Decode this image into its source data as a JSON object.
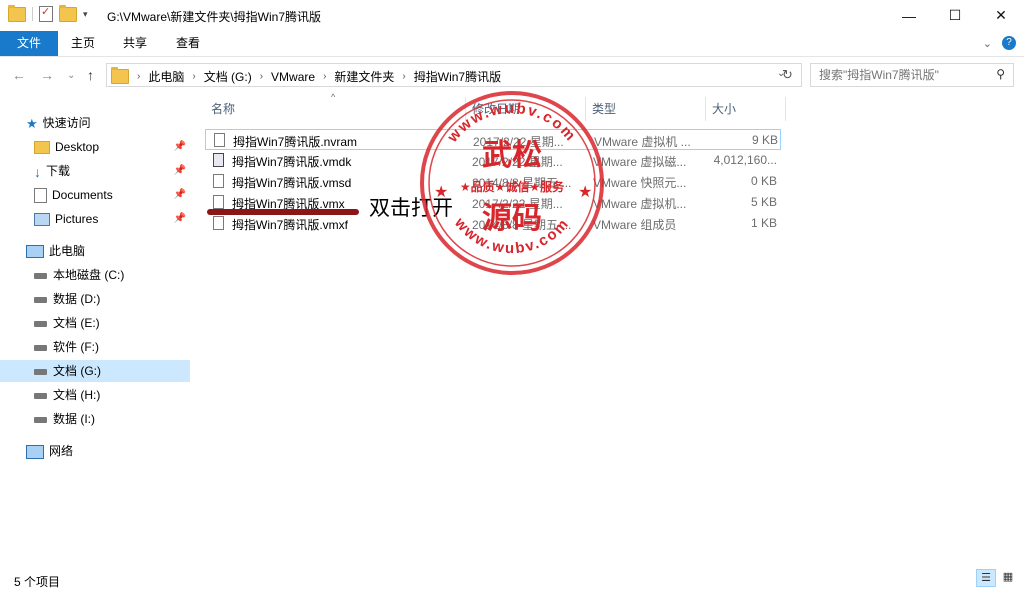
{
  "window": {
    "title": "G:\\VMware\\新建文件夹\\拇指Win7腾讯版",
    "minimize_label": "—",
    "maximize_label": "☐",
    "close_label": "✕"
  },
  "ribbon": {
    "tabs": [
      "文件",
      "主页",
      "共享",
      "查看"
    ],
    "expand_label": "⌄",
    "help_label": "?"
  },
  "address": {
    "crumbs": [
      "此电脑",
      "文档 (G:)",
      "VMware",
      "新建文件夹",
      "拇指Win7腾讯版"
    ]
  },
  "search": {
    "placeholder": "搜索\"拇指Win7腾讯版\""
  },
  "sidebar": {
    "quick_access": "快速访问",
    "pinned": [
      "Desktop",
      "下载",
      "Documents",
      "Pictures"
    ],
    "this_pc": "此电脑",
    "drives": [
      "本地磁盘 (C:)",
      "数据 (D:)",
      "文档 (E:)",
      "软件 (F:)",
      "文档 (G:)",
      "文档 (H:)",
      "数据 (I:)"
    ],
    "network": "网络"
  },
  "columns": [
    "名称",
    "修改日期",
    "类型",
    "大小"
  ],
  "files": [
    {
      "name": "拇指Win7腾讯版.nvram",
      "date": "2017/2/22 星期...",
      "type": "VMware 虚拟机 ...",
      "size": "9 KB"
    },
    {
      "name": "拇指Win7腾讯版.vmdk",
      "date": "2017/2/22 星期...",
      "type": "VMware 虚拟磁...",
      "size": "4,012,160..."
    },
    {
      "name": "拇指Win7腾讯版.vmsd",
      "date": "2014/8/8 星期五 ...",
      "type": "VMware 快照元...",
      "size": "0 KB"
    },
    {
      "name": "拇指Win7腾讯版.vmx",
      "date": "2017/2/22 星期...",
      "type": "VMware 虚拟机...",
      "size": "5 KB"
    },
    {
      "name": "拇指Win7腾讯版.vmxf",
      "date": "2014/8/8 星期五 ...",
      "type": "VMware 组成员",
      "size": "1 KB"
    }
  ],
  "annotation": {
    "text": "双击打开"
  },
  "watermark": {
    "top_arc": "www.wubv.com",
    "bottom_arc": "www.wubv.com",
    "line1": "武松",
    "line2": "源码",
    "slogan": "★品质★诚信★服务"
  },
  "status": {
    "items_count": "5 个项目"
  },
  "colors": {
    "accent": "#1979ca",
    "stamp_red": "#d8262c",
    "annotation_line": "#8b1616"
  }
}
